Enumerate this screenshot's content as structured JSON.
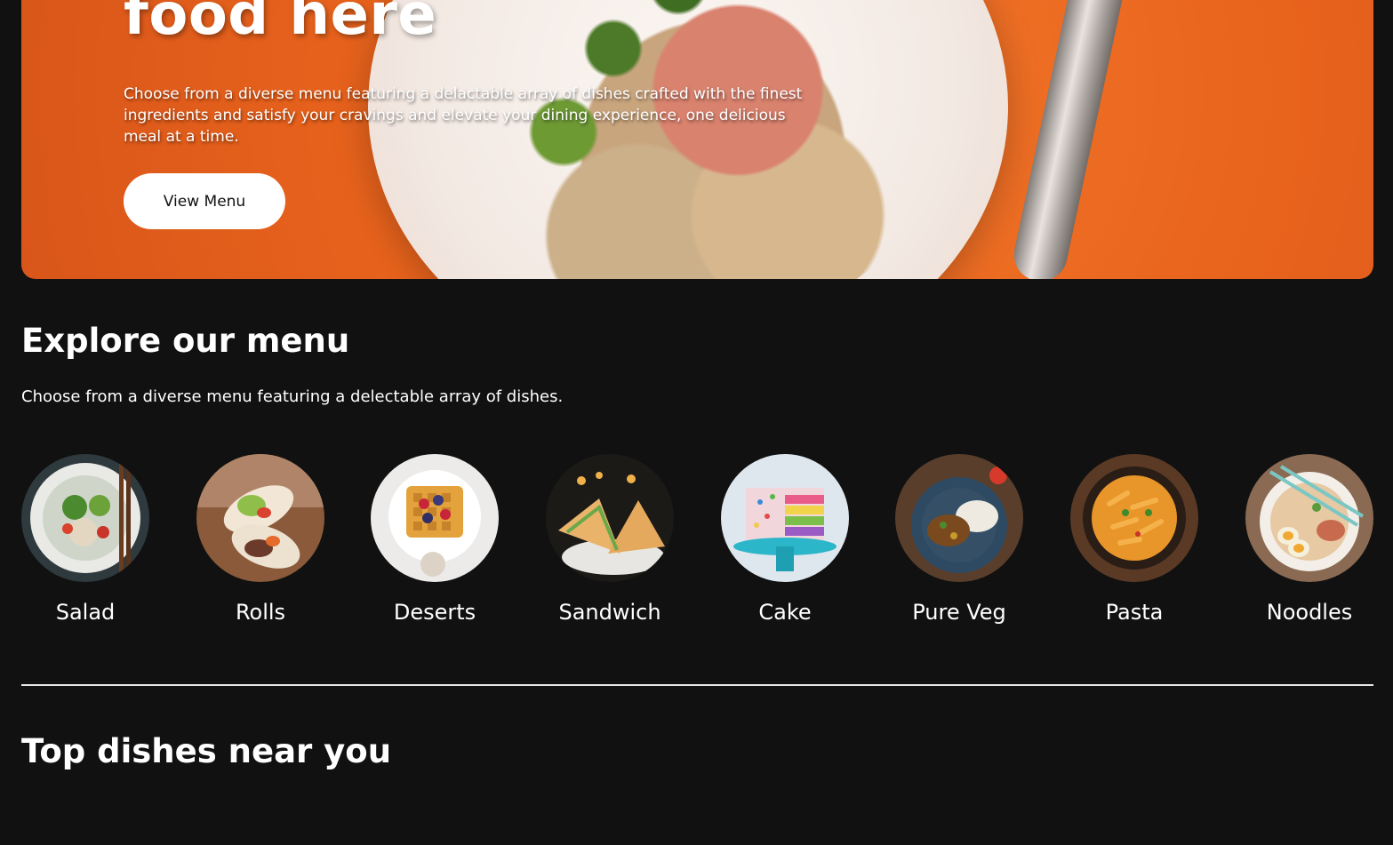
{
  "hero": {
    "title": "food here",
    "description": "Choose from a diverse menu featuring a delactable array of dishes crafted with the finest ingredients and satisfy your cravings and elevate your dining experience, one delicious meal at a time.",
    "button_label": "View Menu"
  },
  "explore": {
    "title": "Explore our menu",
    "description": "Choose from a diverse menu featuring a delectable array of dishes."
  },
  "menu_items": [
    {
      "label": "Salad",
      "icon": "salad-bowl-image"
    },
    {
      "label": "Rolls",
      "icon": "rolls-image"
    },
    {
      "label": "Deserts",
      "icon": "waffle-dessert-image"
    },
    {
      "label": "Sandwich",
      "icon": "sandwich-image"
    },
    {
      "label": "Cake",
      "icon": "cake-image"
    },
    {
      "label": "Pure Veg",
      "icon": "veg-curry-image"
    },
    {
      "label": "Pasta",
      "icon": "pasta-image"
    },
    {
      "label": "Noodles",
      "icon": "noodles-image"
    }
  ],
  "top_dishes": {
    "title": "Top dishes near you"
  },
  "colors": {
    "background": "#111111",
    "hero_orange": "#e8631c",
    "text": "#ffffff",
    "button_bg": "#ffffff"
  }
}
